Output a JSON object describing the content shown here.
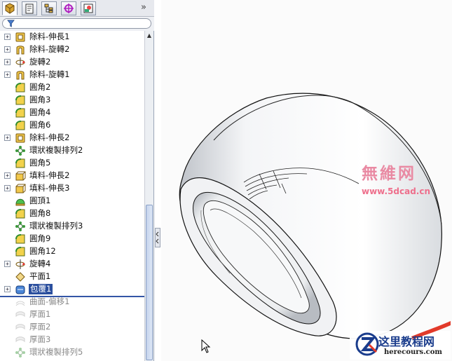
{
  "feature_manager": {
    "tabs": [
      {
        "name": "feature-manager-tab-icon"
      },
      {
        "name": "property-manager-tab-icon"
      },
      {
        "name": "configuration-manager-tab-icon"
      },
      {
        "name": "dimxpert-manager-tab-icon"
      },
      {
        "name": "display-manager-tab-icon"
      }
    ],
    "more_label": "»",
    "filter_placeholder": "",
    "items": [
      {
        "label": "除料-伸長1",
        "icon": "cut-extrude-icon",
        "expandable": true,
        "state": "normal"
      },
      {
        "label": "除料-旋轉2",
        "icon": "cut-revolve-icon",
        "expandable": true,
        "state": "normal"
      },
      {
        "label": "旋轉2",
        "icon": "revolve-icon",
        "expandable": true,
        "state": "normal"
      },
      {
        "label": "除料-旋轉1",
        "icon": "cut-revolve-icon",
        "expandable": true,
        "state": "normal"
      },
      {
        "label": "圓角2",
        "icon": "fillet-icon",
        "expandable": false,
        "state": "normal"
      },
      {
        "label": "圓角3",
        "icon": "fillet-icon",
        "expandable": false,
        "state": "normal"
      },
      {
        "label": "圓角4",
        "icon": "fillet-icon",
        "expandable": false,
        "state": "normal"
      },
      {
        "label": "圓角6",
        "icon": "fillet-icon",
        "expandable": false,
        "state": "normal"
      },
      {
        "label": "除料-伸長2",
        "icon": "cut-extrude-icon",
        "expandable": true,
        "state": "normal"
      },
      {
        "label": "環狀複製排列2",
        "icon": "circular-pattern-icon",
        "expandable": false,
        "state": "normal"
      },
      {
        "label": "圓角5",
        "icon": "fillet-icon",
        "expandable": false,
        "state": "normal"
      },
      {
        "label": "填料-伸長2",
        "icon": "boss-extrude-icon",
        "expandable": true,
        "state": "normal"
      },
      {
        "label": "填料-伸長3",
        "icon": "boss-extrude-icon",
        "expandable": true,
        "state": "normal"
      },
      {
        "label": "圓頂1",
        "icon": "dome-icon",
        "expandable": false,
        "state": "normal"
      },
      {
        "label": "圓角8",
        "icon": "fillet-icon",
        "expandable": false,
        "state": "normal"
      },
      {
        "label": "環狀複製排列3",
        "icon": "circular-pattern-icon",
        "expandable": false,
        "state": "normal"
      },
      {
        "label": "圓角9",
        "icon": "fillet-icon",
        "expandable": false,
        "state": "normal"
      },
      {
        "label": "圓角12",
        "icon": "fillet-icon",
        "expandable": false,
        "state": "normal"
      },
      {
        "label": "旋轉4",
        "icon": "revolve-icon",
        "expandable": true,
        "state": "normal"
      },
      {
        "label": "平面1",
        "icon": "plane-icon",
        "expandable": false,
        "state": "normal"
      },
      {
        "label": "包覆1",
        "icon": "wrap-icon",
        "expandable": true,
        "state": "selected"
      },
      {
        "label": "曲面-偏移1",
        "icon": "offset-surface-icon",
        "expandable": false,
        "state": "suppressed"
      },
      {
        "label": "厚面1",
        "icon": "thicken-icon",
        "expandable": false,
        "state": "suppressed"
      },
      {
        "label": "厚面2",
        "icon": "thicken-icon",
        "expandable": false,
        "state": "suppressed"
      },
      {
        "label": "厚面3",
        "icon": "thicken-icon",
        "expandable": false,
        "state": "suppressed"
      },
      {
        "label": "環狀複製排列5",
        "icon": "circular-pattern-icon",
        "expandable": false,
        "state": "suppressed"
      }
    ]
  },
  "watermarks": {
    "brand_cn": "無維网",
    "brand_url": "www.5dcad.cn",
    "logo_text": "这里教程网",
    "logo_url": "herecours.com"
  },
  "colors": {
    "selection": "#2b4f9e",
    "rollback_bar": "#3355a6",
    "watermark": "#e98aa3",
    "logo_blue": "#1a3c8c"
  }
}
